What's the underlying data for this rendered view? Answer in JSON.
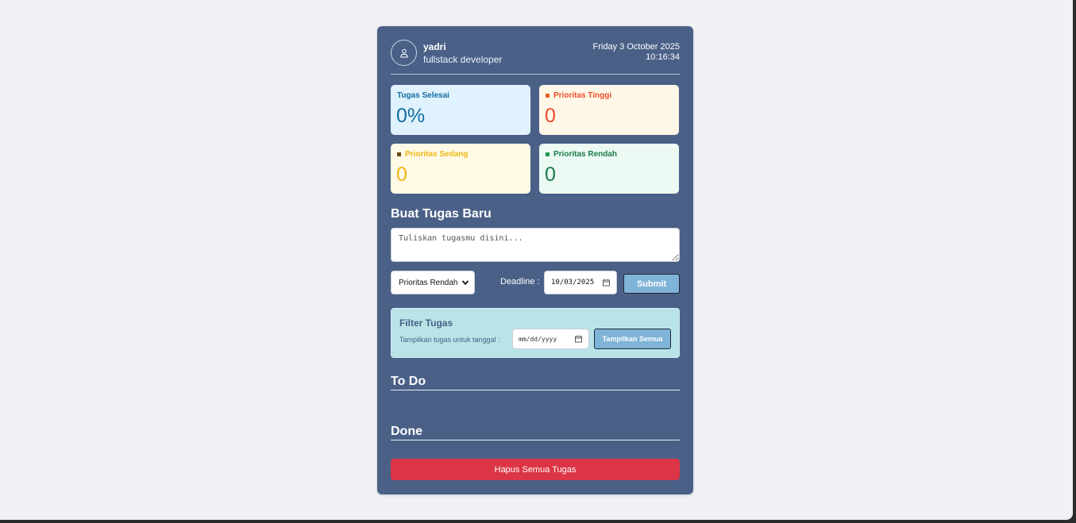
{
  "user": {
    "name": "yadri",
    "role": "fullstack developer",
    "avatar_icon": "user-icon"
  },
  "clock": {
    "date": "Friday 3 October 2025",
    "time": "10:16:34"
  },
  "stats": {
    "completed": {
      "label": "Tugas Selesai",
      "value": "0%",
      "bg": "#e0f2fd",
      "color": "#106ca0"
    },
    "high": {
      "label": "Prioritas Tinggi",
      "value": "0",
      "bg": "#fff8e8",
      "color": "#ee4b2b",
      "marker": "#e0621d"
    },
    "medium": {
      "label": "Prioritas Sedang",
      "value": "0",
      "bg": "#fefae6",
      "color": "#f1b614",
      "marker": "#6b4a10"
    },
    "low": {
      "label": "Prioritas Rendah",
      "value": "0",
      "bg": "#ecfaf3",
      "color": "#1a7a4a",
      "marker": "#1a9a55"
    }
  },
  "new_task": {
    "title": "Buat Tugas Baru",
    "placeholder": "Tuliskan tugasmu disini...",
    "priority_selected": "Prioritas Rendah",
    "deadline_label": "Deadline :",
    "deadline_value": "10/03/2025",
    "submit_label": "Submit"
  },
  "filter": {
    "title": "Filter Tugas",
    "label": "Tampilkan tugas untuk tanggal :",
    "date_placeholder": "mm/dd/yyyy",
    "show_all_label": "Tampilkan Semua"
  },
  "lists": {
    "todo_title": "To Do",
    "done_title": "Done"
  },
  "delete_all_label": "Hapus Semua Tugas"
}
